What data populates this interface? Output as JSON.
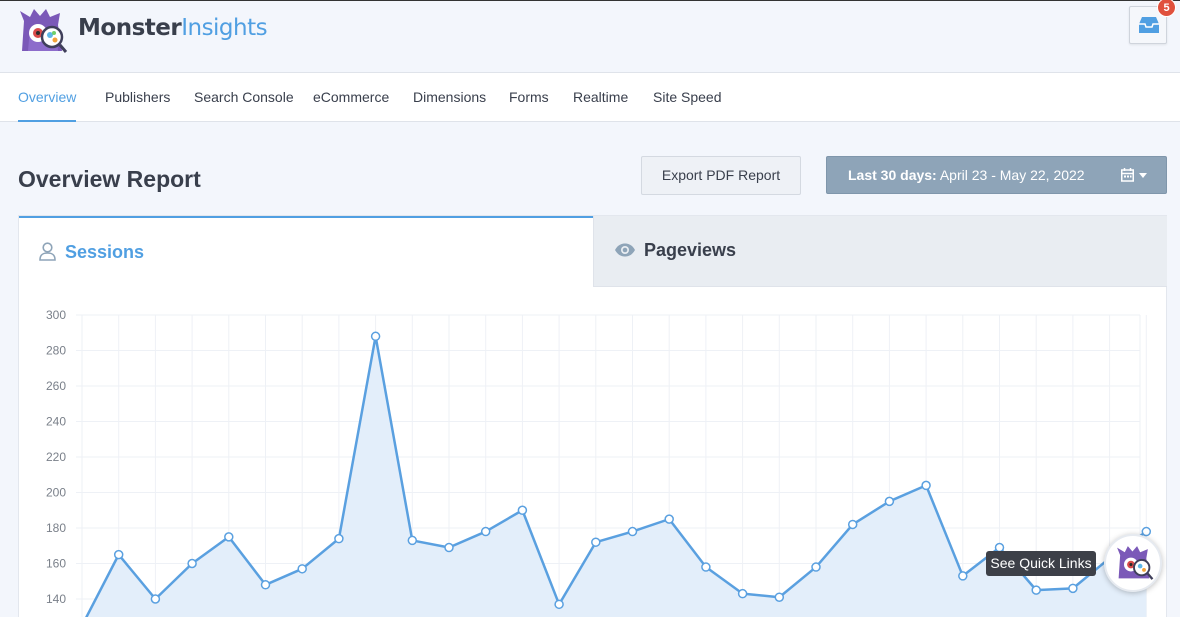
{
  "brand": {
    "name_part1": "Monster",
    "name_part2": "Insights",
    "logo_icon": "monster-logo-icon"
  },
  "header": {
    "inbox_icon": "inbox-icon",
    "notification_count": "5"
  },
  "nav": {
    "items": [
      {
        "label": "Overview",
        "active": true
      },
      {
        "label": "Publishers"
      },
      {
        "label": "Search Console"
      },
      {
        "label": "eCommerce"
      },
      {
        "label": "Dimensions"
      },
      {
        "label": "Forms"
      },
      {
        "label": "Realtime"
      },
      {
        "label": "Site Speed"
      }
    ]
  },
  "page": {
    "title": "Overview Report",
    "export_label": "Export PDF Report",
    "date_range_prefix": "Last 30 days:",
    "date_range_value": "April 23 - May 22, 2022"
  },
  "tabs": [
    {
      "label": "Sessions",
      "icon": "user-icon",
      "active": true
    },
    {
      "label": "Pageviews",
      "icon": "eye-icon",
      "active": false
    }
  ],
  "quick_links": {
    "tooltip": "See Quick Links",
    "icon": "monster-mascot-icon"
  },
  "colors": {
    "accent": "#509fe2",
    "date_button": "#8ea4b8",
    "badge": "#e0513d"
  },
  "chart_data": {
    "type": "area",
    "series": [
      {
        "values": [
          125,
          165,
          140,
          160,
          175,
          148,
          157,
          174,
          288,
          173,
          169,
          178,
          190,
          137,
          172,
          178,
          185,
          158,
          143,
          141,
          158,
          182,
          195,
          204,
          153,
          169,
          145,
          146,
          163,
          178
        ]
      }
    ],
    "yticks": [
      140,
      160,
      180,
      200,
      220,
      240,
      260,
      280,
      300
    ],
    "ylim": [
      120,
      300
    ],
    "grid": true
  }
}
